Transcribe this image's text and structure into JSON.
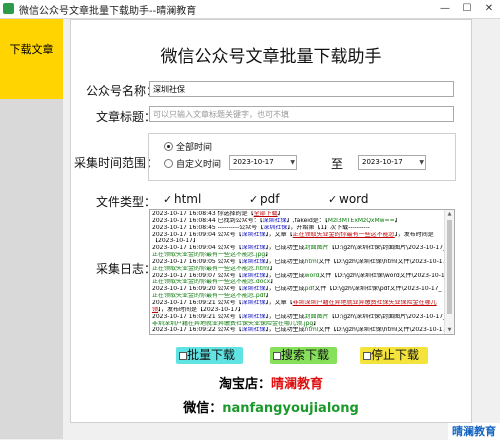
{
  "window": {
    "title": "微信公众号文章批量下载助手--晴澜教育",
    "minimize": "—",
    "maximize": "☐",
    "close": "✕"
  },
  "sidebar": {
    "tab_label": "下载文章"
  },
  "main": {
    "heading": "微信公众号文章批量下载助手",
    "account_label": "公众号名称：",
    "account_value": "深圳社保",
    "title_label": "文章标题：",
    "title_placeholder": "可以只输入文章标题关键字，也可不填",
    "time_label": "采集时间范围：",
    "all_time_label": "全部时间",
    "custom_time_label": "自定义时间",
    "start_date": "2023-10-17",
    "to_label": "至",
    "end_date": "2023-10-17",
    "filetype_label": "文件类型：",
    "filetypes": [
      {
        "label": "html",
        "checked": true
      },
      {
        "label": "pdf",
        "checked": true
      },
      {
        "label": "word",
        "checked": true
      }
    ],
    "log_label": "采集日志：",
    "buttons": {
      "batch": "批量下载",
      "search": "搜索下载",
      "stop": "停止下载"
    },
    "promo_shop_key": "淘宝店：",
    "promo_shop_val": "晴澜教育",
    "promo_wx_key": "微信：",
    "promo_wx_val": "nanfangyoujialong"
  },
  "log_lines": [
    [
      [
        "2023-10-17 16:08:43 你选择的是【",
        ""
      ],
      [
        "全部下载",
        "r"
      ],
      [
        "】",
        ""
      ]
    ],
    [
      [
        "2023-10-17 16:08:44 已找到公众号：【",
        ""
      ],
      [
        "深圳社保",
        "b"
      ],
      [
        "】,fakeid是：【",
        ""
      ],
      [
        "MzI3MTExMzQxMw==",
        "g"
      ],
      [
        "】",
        ""
      ]
    ],
    [
      [
        "2023-10-17 16:08:45 ----------公众号【",
        ""
      ],
      [
        "深圳社保",
        "b"
      ],
      [
        "】，开始第【1】次下载----------",
        ""
      ]
    ],
    [
      [
        "2023-10-17 16:09:04 公众号【",
        ""
      ],
      [
        "深圳社保",
        "b"
      ],
      [
        "】，文章【",
        ""
      ],
      [
        "正在领取失业金的你最有一些这不能忽",
        "r"
      ],
      [
        "】，发布时间是",
        ""
      ]
    ],
    [
      [
        "【2023-10-17】",
        ""
      ]
    ],
    [
      [
        "2023-10-17 16:09:04 公众号【",
        ""
      ],
      [
        "深圳社保",
        "b"
      ],
      [
        "】，已成功生成",
        ""
      ],
      [
        "封面图片",
        "g"
      ],
      [
        "【D:\\gzh\\深圳社保\\封面图片\\2023-10-17_",
        ""
      ]
    ],
    [
      [
        "正在领取失业金的你最有一些这不能忽.jpg",
        "g"
      ],
      [
        "】",
        ""
      ]
    ],
    [
      [
        "2023-10-17 16:09:05 公众号【",
        ""
      ],
      [
        "深圳社保",
        "b"
      ],
      [
        "】，已成功生成",
        ""
      ],
      [
        "html",
        "g"
      ],
      [
        "文件【D:\\gzh\\深圳社保\\html文件\\2023-10-17_",
        ""
      ]
    ],
    [
      [
        "正在领取失业金的你最有一些这不能忽.html",
        "g"
      ],
      [
        "】",
        ""
      ]
    ],
    [
      [
        "2023-10-17 16:09:07 公众号【",
        ""
      ],
      [
        "深圳社保",
        "b"
      ],
      [
        "】，已成功生成",
        ""
      ],
      [
        "word",
        "g"
      ],
      [
        "文件【D:\\gzh\\深圳社保\\word文件\\2023-10-17_",
        ""
      ]
    ],
    [
      [
        "正在领取失业金的你最有一些这不能忽.docx",
        "g"
      ],
      [
        "】",
        ""
      ]
    ],
    [
      [
        "2023-10-17 16:09:20 公众号【",
        ""
      ],
      [
        "深圳社保",
        "b"
      ],
      [
        "】，已成功生成",
        ""
      ],
      [
        "pdf",
        "g"
      ],
      [
        "文件【D:\\gzh\\深圳社保\\pdf文件\\2023-10-17_",
        ""
      ]
    ],
    [
      [
        "正在领取失业金的你最有一些这不能忽.pdf",
        "g"
      ],
      [
        "】",
        ""
      ]
    ],
    [
      [
        "2023-10-17 16:09:21 公众号【",
        ""
      ],
      [
        "深圳社保",
        "b"
      ],
      [
        "】，文章【",
        ""
      ],
      [
        "非圳深圳户籍在异地就业异缴费社保失业保险金在哪儿",
        "r"
      ]
    ],
    [
      [
        "领",
        "r"
      ],
      [
        "】，发布时间是【2023-10-17】",
        ""
      ]
    ],
    [
      [
        "2023-10-17 16:09:21 公众号【",
        ""
      ],
      [
        "深圳社保",
        "b"
      ],
      [
        "】，已成功生成",
        ""
      ],
      [
        "封面图片",
        "g"
      ],
      [
        "【D:\\gzh\\深圳社保\\封面图片\\2023-10-17_",
        ""
      ]
    ],
    [
      [
        "非圳深圳户籍在异地就业异缴费社保失业保险金在哪儿领.jpg",
        "g"
      ],
      [
        "】",
        ""
      ]
    ],
    [
      [
        "2023-10-17 16:09:22 公众号【",
        ""
      ],
      [
        "深圳社保",
        "b"
      ],
      [
        "】，已成功生成",
        ""
      ],
      [
        "html",
        "g"
      ],
      [
        "文件【D:\\gzh\\深圳社保\\html文件\\2023-10-17_",
        ""
      ]
    ]
  ],
  "brand_tab": "晴澜教育"
}
